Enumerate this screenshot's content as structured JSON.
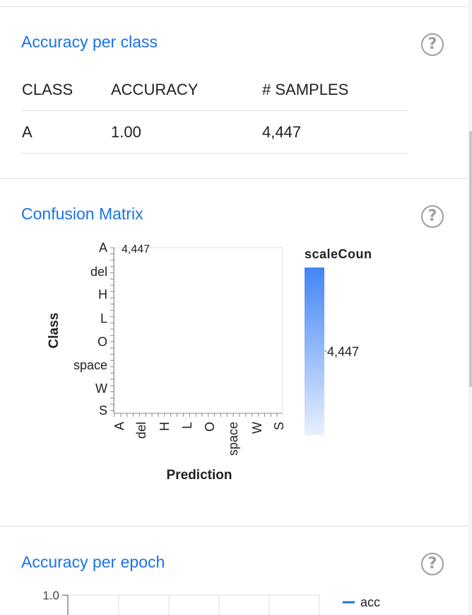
{
  "accuracy_per_class": {
    "title": "Accuracy per class",
    "help_icon": "help-circle-icon",
    "columns": [
      "CLASS",
      "ACCURACY",
      "# SAMPLES"
    ],
    "rows": [
      {
        "class": "A",
        "accuracy": "1.00",
        "samples": "4,447"
      }
    ]
  },
  "confusion_matrix": {
    "title": "Confusion Matrix",
    "help_icon": "help-circle-icon",
    "cell_value_label": "4,447",
    "legend_title": "scaleCoun",
    "legend_value_label": "4,447",
    "legend_color_top": "#4285f4",
    "legend_color_bottom": "#e8f0fe"
  },
  "accuracy_per_epoch": {
    "title": "Accuracy per epoch",
    "help_icon": "help-circle-icon",
    "y_tick": "1.0",
    "legend_label": "acc",
    "series_color": "#1a73e8"
  },
  "chart_data": [
    {
      "type": "heatmap",
      "title": "",
      "xlabel": "Prediction",
      "ylabel": "Class",
      "categories": [
        "A",
        "del",
        "H",
        "L",
        "O",
        "space",
        "W",
        "S"
      ],
      "cells": [
        {
          "class": "A",
          "prediction": "A",
          "count": 4447
        }
      ],
      "legend_title": "scaleCoun",
      "legend_ticks": [
        "4,447"
      ],
      "legend_placement": "right"
    },
    {
      "type": "line",
      "title": "",
      "y_ticks": [
        "1.0"
      ],
      "series": [
        {
          "name": "acc",
          "values": []
        }
      ],
      "legend_placement": "top-right",
      "grid": true
    }
  ]
}
